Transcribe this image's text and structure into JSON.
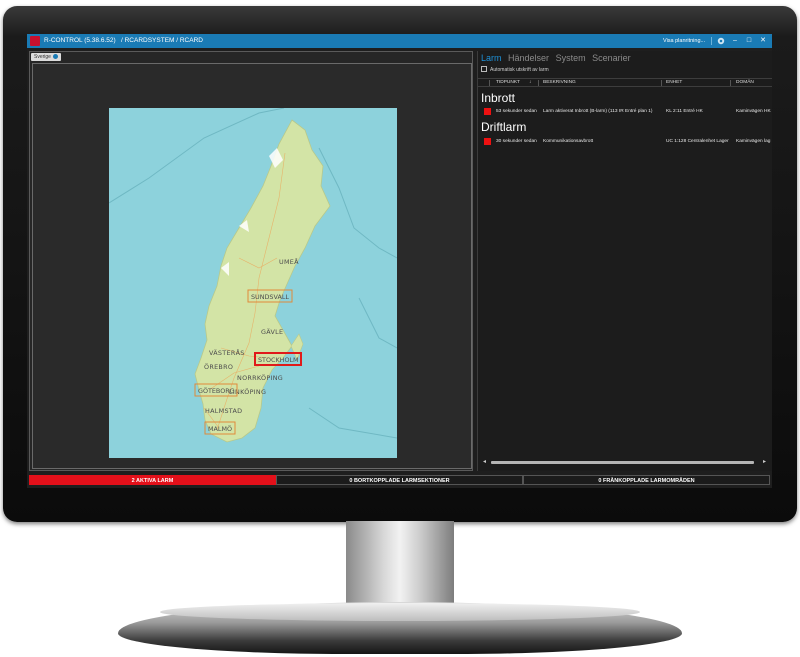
{
  "window": {
    "title": "R-CONTROL (5.38.6.52)",
    "path": "/ RCARDSYSTEM / RCARD",
    "view_link": "Visa planritning...",
    "controls": {
      "settings_icon": "gear-icon",
      "minimize": "–",
      "maximize": "□",
      "close": "✕"
    }
  },
  "map_panel": {
    "tab_label": "Sverige",
    "cities": {
      "umea": "UMEÅ",
      "sundsvall": "SUNDSVALL",
      "gavle": "GÄVLE",
      "vasteras": "VÄSTERÅS",
      "stockholm": "STOCKHOLM",
      "orebro": "ÖREBRO",
      "norrkoping": "NORRKÖPING",
      "linkoping": "LINKÖPING",
      "goteborg": "GÖTEBORG",
      "halmstad": "HALMSTAD",
      "malmo": "MALMÖ"
    },
    "colors": {
      "sea": "#8dd2dc",
      "land": "#d3e4a6",
      "alarm_box": "#e01a1a",
      "area_box": "#e08a3a"
    }
  },
  "alarm_panel": {
    "tabs": [
      {
        "label": "Larm",
        "active": true
      },
      {
        "label": "Händelser",
        "active": false
      },
      {
        "label": "System",
        "active": false
      },
      {
        "label": "Scenarier",
        "active": false
      }
    ],
    "auto_print_label": "Automatisk utskrift av larm",
    "columns": {
      "time": "TIDPUNKT",
      "sort": "↓",
      "description": "BESKRIVNING",
      "unit": "ENHET",
      "domain": "DOMÄN"
    },
    "groups": [
      {
        "name": "Inbrott",
        "rows": [
          {
            "time": "53 sekunder sedan",
            "description": "Larm aktiverat Inbrott (B-larm) (113 IR Entré plan 1)",
            "unit": "KL 2:11 Entré HK",
            "domain": "Kaminvägen HK"
          }
        ]
      },
      {
        "name": "Driftlarm",
        "rows": [
          {
            "time": "30 sekunder sedan",
            "description": "Kommunikationsavbrott",
            "unit": "UC 1:128 Centralenhet Lager",
            "domain": "Kaminvägen lag"
          }
        ]
      }
    ]
  },
  "status_bar": {
    "active_alarms": "2 AKTIVA LARM",
    "disconnected_sections": "0 BORTKOPPLADE LARMSEKTIONER",
    "disconnected_areas": "0 FRÅNKOPPLADE LARMOMRÅDEN"
  }
}
